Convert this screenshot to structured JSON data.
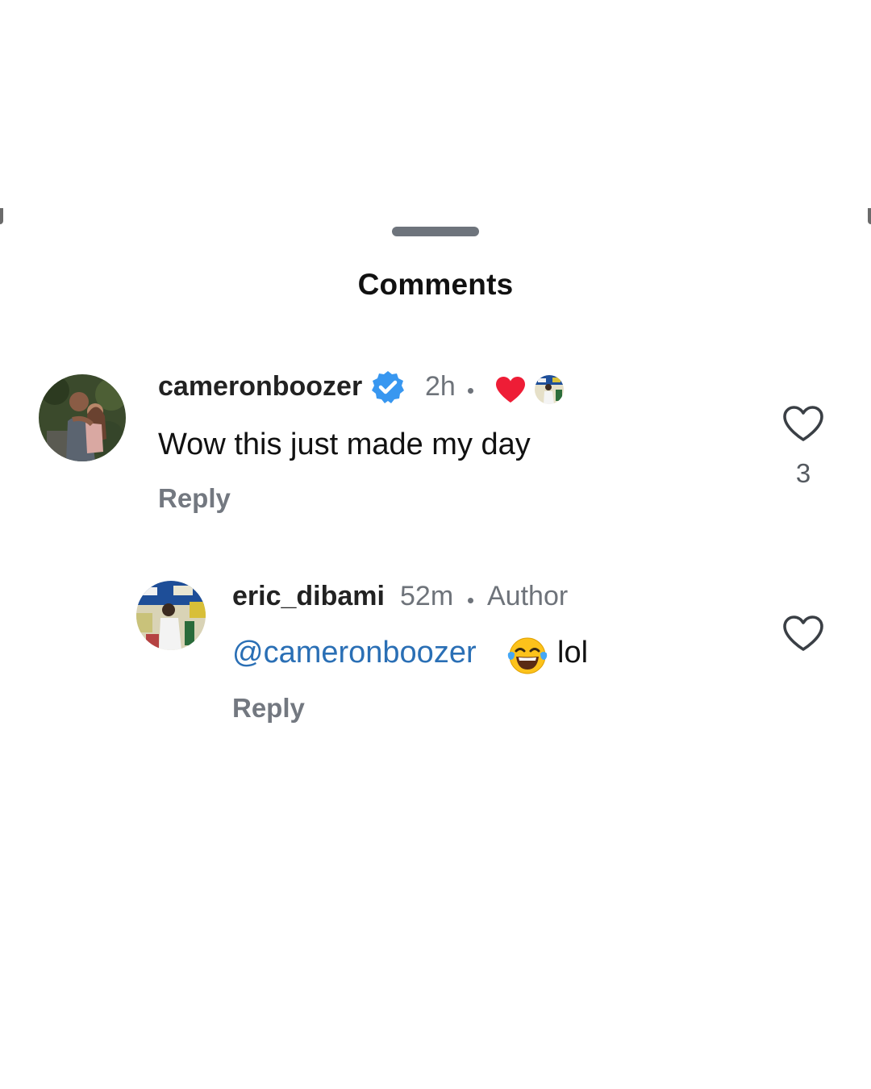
{
  "header": {
    "title": "Comments"
  },
  "comments": [
    {
      "username": "cameronboozer",
      "verified": true,
      "time": "2h",
      "text": "Wow this just made my day",
      "reply_label": "Reply",
      "like_count": "3",
      "avatar_icon": "couple-photo-avatar",
      "liked_by_author_icons": [
        "red-heart-icon",
        "author-mini-avatar"
      ]
    },
    {
      "username": "eric_dibami",
      "time": "52m",
      "author_badge": "Author",
      "mention": "@cameronboozer",
      "emoji_icon": "face-with-tears-of-joy-emoji",
      "text_after": "lol",
      "reply_label": "Reply",
      "avatar_icon": "basketball-player-avatar"
    }
  ],
  "colors": {
    "mention": "#2a6fb5",
    "heart": "#ee1d36",
    "verified": "#3897f0",
    "muted": "#6e737a"
  }
}
